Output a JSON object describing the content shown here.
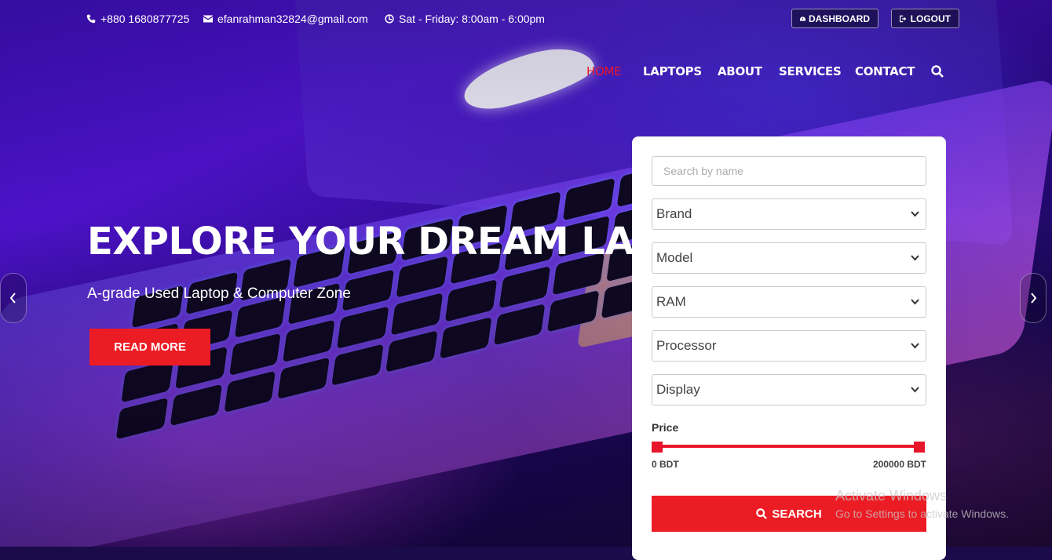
{
  "topbar": {
    "phone": "+880 1680877725",
    "email": "efanrahman32824@gmail.com",
    "hours": "Sat - Friday: 8:00am - 6:00pm",
    "dashboard_label": "DASHBOARD",
    "logout_label": "LOGOUT"
  },
  "nav": {
    "items": [
      {
        "label": "HOME",
        "active": true
      },
      {
        "label": "LAPTOPS"
      },
      {
        "label": "ABOUT"
      },
      {
        "label": "SERVICES"
      },
      {
        "label": "CONTACT"
      }
    ],
    "search_icon": "search-icon"
  },
  "hero": {
    "title": "EXPLORE YOUR DREAM LAPTOP",
    "subtitle": "A-grade Used Laptop & Computer Zone",
    "button_label": "READ MORE"
  },
  "filter": {
    "search_placeholder": "Search by name",
    "selects": [
      "Brand",
      "Model",
      "RAM",
      "Processor",
      "Display"
    ],
    "price_label": "Price",
    "price_min": "0 BDT",
    "price_max": "200000 BDT",
    "search_label": "SEARCH"
  },
  "watermark": {
    "title": "Activate Windows",
    "subtitle": "Go to Settings to activate Windows."
  },
  "colors": {
    "accent": "#ec1c24",
    "nav_active": "#e8162b"
  }
}
